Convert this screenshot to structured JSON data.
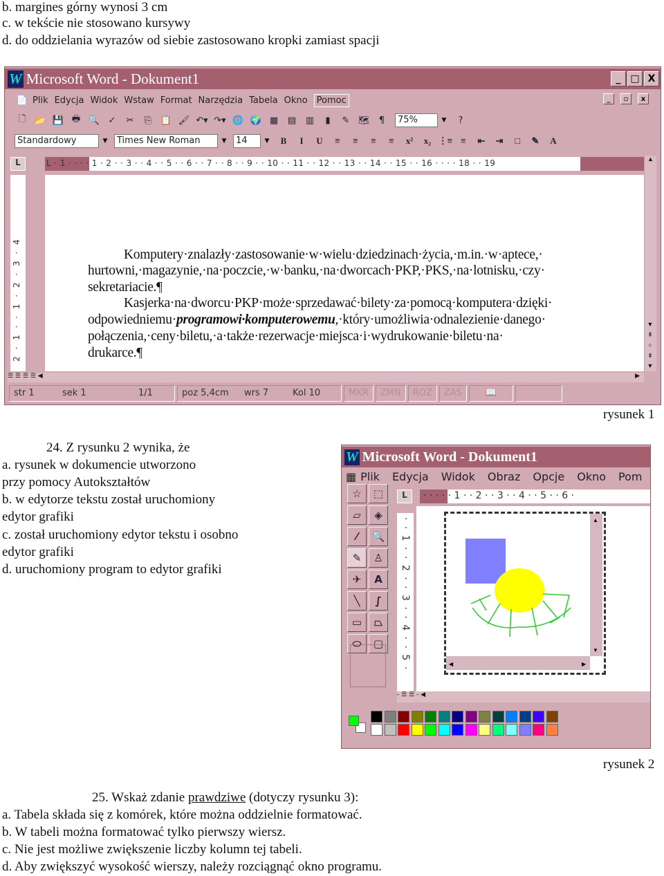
{
  "top_lines": [
    "b. margines górny wynosi 3 cm",
    "c. w tekście nie stosowano kursywy",
    "d. do oddzielania wyrazów od siebie zastosowano kropki zamiast spacji"
  ],
  "fig1": {
    "title": "Microsoft Word - Dokument1",
    "logo": "W",
    "window_buttons": [
      "_",
      "□",
      "X"
    ],
    "doc_buttons": [
      "_",
      "▫",
      "x"
    ],
    "menu": [
      "Plik",
      "Edycja",
      "Widok",
      "Wstaw",
      "Format",
      "Narzędzia",
      "Tabela",
      "Okno",
      "Pomoc"
    ],
    "toolbar_icons": [
      "new-icon",
      "open-icon",
      "save-icon",
      "print-icon",
      "print-preview-icon",
      "spelling-icon",
      "cut-icon",
      "copy-icon",
      "paste-icon",
      "format-painter-icon",
      "undo-icon",
      "redo-icon",
      "hyperlink-icon",
      "web-toolbar-icon",
      "tables-borders-icon",
      "insert-table-icon",
      "insert-excel-icon",
      "columns-icon",
      "drawing-icon",
      "document-map-icon",
      "show-formatting-icon",
      "help-icon"
    ],
    "zoom": "75%",
    "style": "Standardowy",
    "font": "Times New Roman",
    "size": "14",
    "format_icons": [
      "B",
      "I",
      "U",
      "≡",
      "≡",
      "≡",
      "≡",
      "x²",
      "x₂",
      "⋮≡",
      "≡",
      "⇤",
      "⇥",
      "□",
      "✎",
      "A"
    ],
    "ruler": "L  · 1 · ·  · · 1 · 2 · · 3 · · 4 · · 5 · · 6 · · 7 · · 8 · · 9 · · 10 · · 11 · · 12 · · 13 · · 14 · · 15 · · 16 · ·  · · 18 · · 19",
    "vruler": "2 · 1 · · 1 · 2 · 3 · 4",
    "paragraphs": [
      [
        "Komputery·znalazły·zastosowanie·w·wielu·dziedzinach·życia,·m.in.·w·aptece,·",
        "hurtowni,·magazynie,·na·poczcie,·w·banku,·na·dworcach·PKP,·PKS,·na·lotnisku,·czy·",
        "sekretariacie.¶"
      ],
      [
        "Kasjerka·na·dworcu·PKP·może·sprzedawać·bilety·za·pomocą·komputera·dzięki·"
      ],
      [
        "odpowiedniemu·",
        "programowi·komputerowemu",
        ",·który·umożliwia·odnalezienie·danego·"
      ],
      [
        "połączenia,·ceny·biletu,·a·także·rezerwacje·miejsca·i·wydrukowanie·biletu·na·",
        "drukarce.¶"
      ]
    ],
    "status": {
      "str": "str  1",
      "sek": "sek  1",
      "pages": "1/1",
      "poz": "poz  5,4cm",
      "wrs": "wrs  7",
      "kol": "Kol  10",
      "mkr": "MKR",
      "zmn": "ZMN",
      "roz": "ROZ",
      "zas": "ZAS"
    },
    "caption": "rysunek 1"
  },
  "q24": {
    "lines": [
      "24. Z rysunku 2 wynika, że",
      "a. rysunek w dokumencie utworzono",
      "przy pomocy Autokształtów",
      "b. w edytorze tekstu został uruchomiony",
      "edytor grafiki",
      "c. został uruchomiony edytor tekstu      i osobno",
      "edytor grafiki",
      "d. uruchomiony program to edytor grafiki"
    ]
  },
  "fig2": {
    "title": "Microsoft Word - Dokument1",
    "logo": "W",
    "menu": [
      "Plik",
      "Edycja",
      "Widok",
      "Obraz",
      "Opcje",
      "Okno",
      "Pom"
    ],
    "tools": [
      "free-select-icon",
      "rect-select-icon",
      "eraser-icon",
      "fill-icon",
      "color-picker-icon",
      "magnifier-icon",
      "pencil-icon",
      "brush-icon",
      "airbrush-icon",
      "text-icon",
      "line-icon",
      "curve-icon",
      "rectangle-icon",
      "polygon-icon",
      "ellipse-icon",
      "rounded-rect-icon"
    ],
    "ruler": "· · ·  · · 1 · · 2 · · 3 · · 4 · · 5 · · 6 ·",
    "vruler": "· · 1 · · 2 · · 3 · · 4 · · 5 ·",
    "foreground_color": "#00ff00",
    "background_color": "#ffffff",
    "palette_top": [
      "#000000",
      "#808080",
      "#800000",
      "#808000",
      "#008000",
      "#008080",
      "#000080",
      "#800080",
      "#808040",
      "#004040",
      "#0080ff",
      "#004080",
      "#4000ff",
      "#804000"
    ],
    "palette_bottom": [
      "#ffffff",
      "#c0c0c0",
      "#ff0000",
      "#ffff00",
      "#00ff00",
      "#00ffff",
      "#0000ff",
      "#ff00ff",
      "#ffff80",
      "#00ff80",
      "#80ffff",
      "#8080ff",
      "#ff0080",
      "#ff8040"
    ],
    "caption": "rysunek 2"
  },
  "q25": {
    "prefix": "25. Wskaż zdanie ",
    "underlined": "prawdziwe",
    "suffix": " (dotyczy rysunku 3):",
    "lines": [
      "a. Tabela składa się z komórek, które można oddzielnie formatować.",
      "b. W tabeli można formatować tylko pierwszy wiersz.",
      "c. Nie jest możliwe zwiększenie liczby kolumn tej tabeli.",
      "d. Aby zwiększyć wysokość wierszy, należy rozciągnąć okno programu."
    ]
  },
  "colors": {
    "title_bar": "#a4606f",
    "window": "#d2aab4"
  }
}
